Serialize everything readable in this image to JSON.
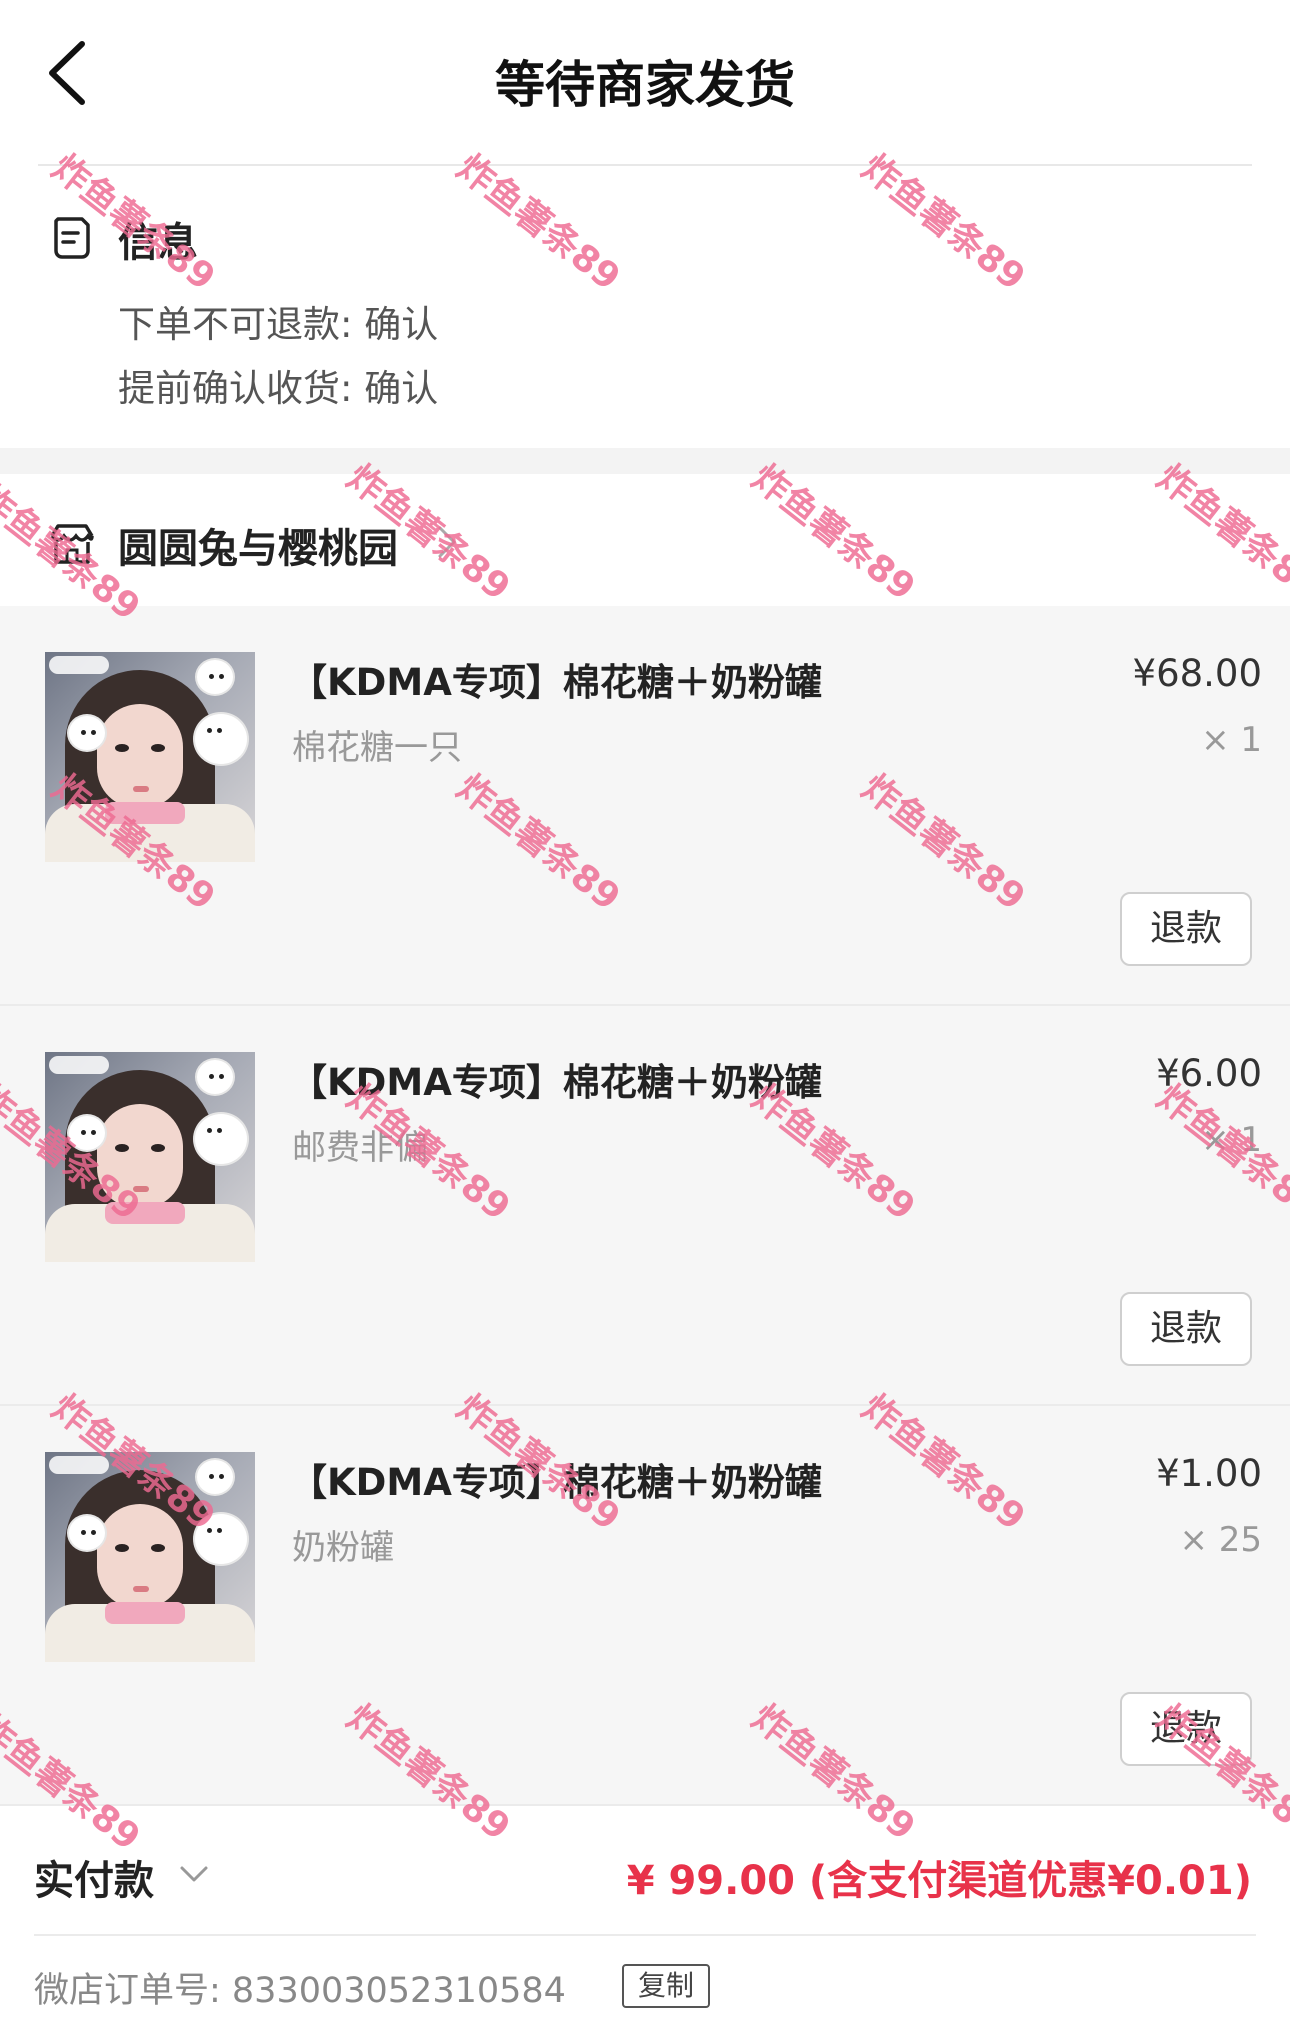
{
  "nav": {
    "title": "等待商家发货",
    "back_icon": "chevron-left-icon"
  },
  "info": {
    "icon": "info-doc-icon",
    "title": "信息",
    "lines": [
      "下单不可退款: 确认",
      "提前确认收货: 确认"
    ]
  },
  "shop": {
    "icon": "shop-icon",
    "name": "圆圆兔与樱桃园",
    "chevron_icon": "chevron-right-icon"
  },
  "items": [
    {
      "name": "【KDMA专项】棉花糖＋奶粉罐",
      "sku": "棉花糖一只",
      "price": "¥68.00",
      "qty": "× 1",
      "refund": "退款",
      "thumb": "product-photo"
    },
    {
      "name": "【KDMA专项】棉花糖＋奶粉罐",
      "sku": "邮费非偏",
      "price": "¥6.00",
      "qty": "× 1",
      "refund": "退款",
      "thumb": "product-photo"
    },
    {
      "name": "【KDMA专项】棉花糖＋奶粉罐",
      "sku": "奶粉罐",
      "price": "¥1.00",
      "qty": "× 25",
      "refund": "退款",
      "thumb": "product-photo"
    }
  ],
  "payment": {
    "label": "实付款",
    "chevron_icon": "chevron-down-icon",
    "amount": "¥ 99.00 (含支付渠道优惠¥0.01)"
  },
  "order": {
    "label": "微店订单号:  833003052310584",
    "copy_label": "复制"
  },
  "watermark": {
    "text": "炸鱼薯条89",
    "color": "#ee6a92"
  },
  "colors": {
    "accent_red": "#e8324a",
    "watermark_pink": "#ee6a92"
  }
}
